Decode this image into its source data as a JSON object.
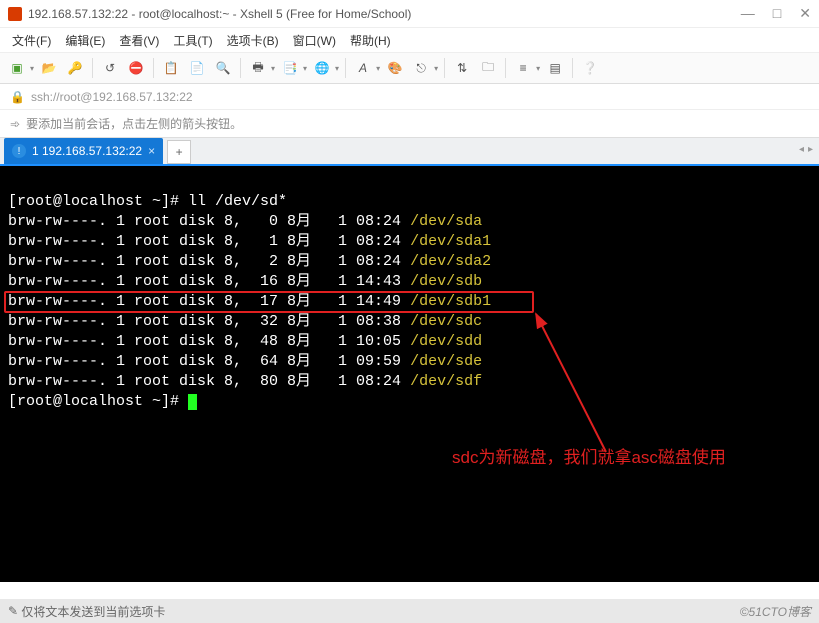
{
  "window": {
    "title": "192.168.57.132:22 - root@localhost:~ - Xshell 5 (Free for Home/School)"
  },
  "menu": {
    "file": "文件(F)",
    "edit": "编辑(E)",
    "view": "查看(V)",
    "tools": "工具(T)",
    "tabs": "选项卡(B)",
    "window": "窗口(W)",
    "help": "帮助(H)"
  },
  "address": {
    "url": "ssh://root@192.168.57.132:22"
  },
  "hint": {
    "text": "要添加当前会话，点击左侧的箭头按钮。"
  },
  "tab": {
    "label": "1 192.168.57.132:22"
  },
  "terminal": {
    "prompt1": "[root@localhost ~]# ",
    "cmd1": "ll /dev/sd*",
    "lines": [
      {
        "perm": "brw-rw----. 1 root disk 8,   0 8月   1 08:24 ",
        "dev": "/dev/sda"
      },
      {
        "perm": "brw-rw----. 1 root disk 8,   1 8月   1 08:24 ",
        "dev": "/dev/sda1"
      },
      {
        "perm": "brw-rw----. 1 root disk 8,   2 8月   1 08:24 ",
        "dev": "/dev/sda2"
      },
      {
        "perm": "brw-rw----. 1 root disk 8,  16 8月   1 14:43 ",
        "dev": "/dev/sdb"
      },
      {
        "perm": "brw-rw----. 1 root disk 8,  17 8月   1 14:49 ",
        "dev": "/dev/sdb1"
      },
      {
        "perm": "brw-rw----. 1 root disk 8,  32 8月   1 08:38 ",
        "dev": "/dev/sdc"
      },
      {
        "perm": "brw-rw----. 1 root disk 8,  48 8月   1 10:05 ",
        "dev": "/dev/sdd"
      },
      {
        "perm": "brw-rw----. 1 root disk 8,  64 8月   1 09:59 ",
        "dev": "/dev/sde"
      },
      {
        "perm": "brw-rw----. 1 root disk 8,  80 8月   1 08:24 ",
        "dev": "/dev/sdf"
      }
    ],
    "prompt2": "[root@localhost ~]# ",
    "annotation": "sdc为新磁盘，我们就拿asc磁盘使用"
  },
  "status": {
    "text": "仅将文本发送到当前选项卡",
    "watermark": "©51CTO博客"
  }
}
